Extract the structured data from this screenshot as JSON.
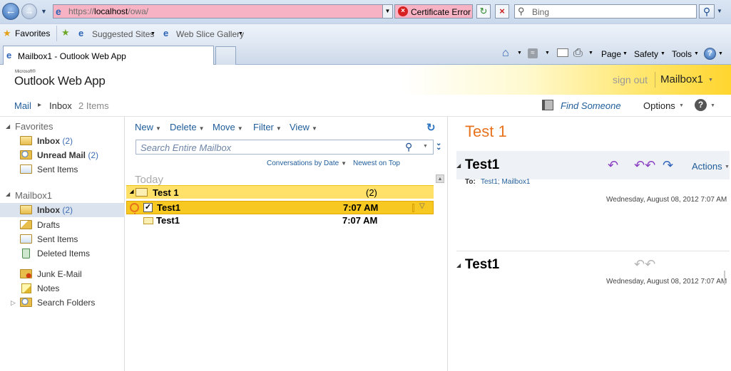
{
  "browser": {
    "address": {
      "prefix": "https://",
      "host": "localhost",
      "path": "/owa/"
    },
    "cert_error": "Certificate Error",
    "search_placeholder": "Bing",
    "favorites_label": "Favorites",
    "suggested_sites": "Suggested Sites",
    "web_slice_gallery": "Web Slice Gallery",
    "tab_title": "Mailbox1 - Outlook Web App",
    "cmd": {
      "page": "Page",
      "safety": "Safety",
      "tools": "Tools"
    }
  },
  "owa": {
    "brand_small": "Microsoft®",
    "brand": "Outlook Web App",
    "sign_out": "sign out",
    "mailbox": "Mailbox1",
    "breadcrumb": {
      "mail": "Mail",
      "inbox": "Inbox",
      "count": "2 Items"
    },
    "find_someone": "Find Someone",
    "options": "Options",
    "help": "?"
  },
  "nav": {
    "favorites_header": "Favorites",
    "favorites": [
      {
        "label": "Inbox",
        "count": "(2)",
        "bold": true
      },
      {
        "label": "Unread Mail",
        "count": "(2)",
        "bold": true
      },
      {
        "label": "Sent Items",
        "count": "",
        "bold": false
      }
    ],
    "mailbox_header": "Mailbox1",
    "folders": [
      {
        "label": "Inbox",
        "count": "(2)"
      },
      {
        "label": "Drafts",
        "count": ""
      },
      {
        "label": "Sent Items",
        "count": ""
      },
      {
        "label": "Deleted Items",
        "count": ""
      },
      {
        "label": "Junk E-Mail",
        "count": ""
      },
      {
        "label": "Notes",
        "count": ""
      },
      {
        "label": "Search Folders",
        "count": ""
      }
    ]
  },
  "toolbar": {
    "new": "New",
    "delete": "Delete",
    "move": "Move",
    "filter": "Filter",
    "view": "View"
  },
  "list": {
    "search_placeholder": "Search Entire Mailbox",
    "arrange": "Conversations by Date",
    "order": "Newest on Top",
    "group": "Today",
    "conversation": {
      "subject": "Test 1",
      "count": "(2)"
    },
    "messages": [
      {
        "subject": "Test1",
        "time": "7:07 AM"
      },
      {
        "subject": "Test1",
        "time": "7:07 AM"
      }
    ]
  },
  "reading": {
    "title": "Test 1",
    "messages": [
      {
        "subject": "Test1",
        "to_label": "To:",
        "to": "Test1; Mailbox1",
        "date": "Wednesday, August 08, 2012 7:07 AM",
        "actions": "Actions"
      },
      {
        "subject": "Test1",
        "date": "Wednesday, August 08, 2012 7:07 AM"
      }
    ]
  },
  "colors": {
    "accent_orange": "#e8731e",
    "link_blue": "#1f5c9a",
    "selected_row": "#f7c821",
    "conv_header": "#ffe16a"
  }
}
